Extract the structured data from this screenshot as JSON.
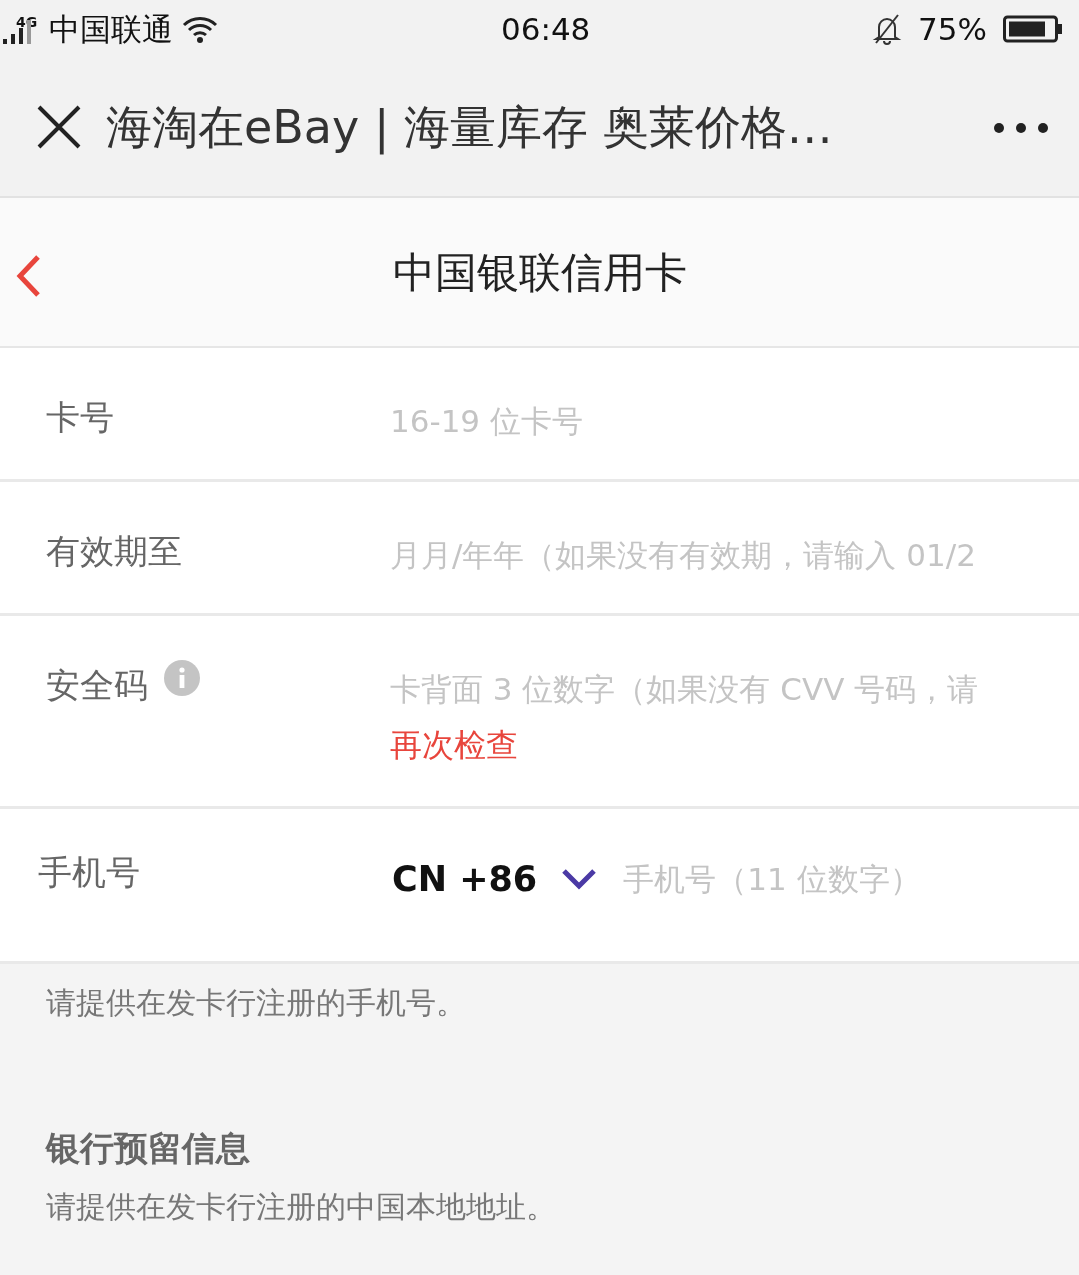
{
  "status_bar": {
    "network": "4G",
    "carrier": "中国联通",
    "time": "06:48",
    "battery": "75%"
  },
  "browser_bar": {
    "title": "海淘在eBay | 海量库存 奥莱价格…"
  },
  "page_header": {
    "title": "中国银联信用卡"
  },
  "fields": [
    {
      "kind": "text",
      "label": "卡号",
      "placeholder": "16-19 位卡号"
    },
    {
      "kind": "text",
      "label": "有效期至",
      "placeholder": "月月/年年（如果没有有效期，请输入 01/2"
    },
    {
      "kind": "text",
      "label": "安全码",
      "info": true,
      "placeholder": "卡背面 3 位数字（如果没有 CVV 号码，请",
      "error": "再次检查"
    },
    {
      "kind": "phone",
      "label": "手机号",
      "country_code": "CN +86",
      "placeholder": "手机号（11 位数字）"
    }
  ],
  "hint": "请提供在发卡行注册的手机号。",
  "section": {
    "title": "银行预留信息",
    "description": "请提供在发卡行注册的中国本地地址。"
  }
}
